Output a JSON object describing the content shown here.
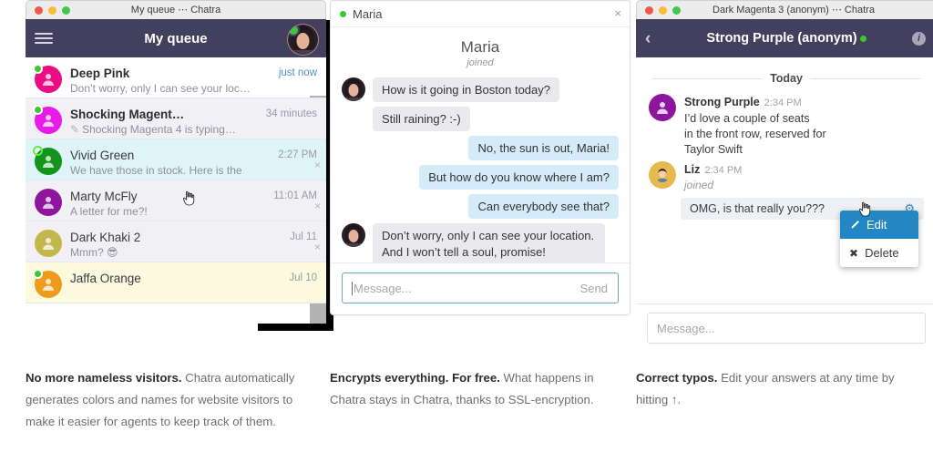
{
  "window1": {
    "titlebar": "My queue ⋯ Chatra",
    "appbar_title": "My queue",
    "menu_icon": "hamburger-icon",
    "rows": [
      {
        "name": "Deep Pink",
        "preview": "Don’t worry, only I can see your loc…",
        "time": "just now",
        "color": "#ec0d86",
        "presence": "solid",
        "typing": false
      },
      {
        "name": "Shocking Magent…",
        "preview": "Shocking Magenta 4 is typing…",
        "time": "34 minutes",
        "color": "#e81ce8",
        "presence": "solid",
        "typing": true
      },
      {
        "name": "Vivid Green",
        "preview": "We have those in stock. Here is the",
        "time": "2:27 PM",
        "color": "#11951b",
        "presence": "ring",
        "typing": false
      },
      {
        "name": "Marty McFly",
        "preview": "A letter for me?!",
        "time": "11:01 AM",
        "color": "#8e169e",
        "presence": "none",
        "typing": false
      },
      {
        "name": "Dark Khaki 2",
        "preview": "Mmm? 😎",
        "time": "Jul 11",
        "color": "#c0b84b",
        "presence": "none",
        "typing": false
      },
      {
        "name": "Jaffa Orange",
        "preview": "",
        "time": "Jul 10",
        "color": "#ef9b1c",
        "presence": "solid",
        "typing": false
      }
    ]
  },
  "window2": {
    "header_name": "Maria",
    "close_label": "×",
    "joined_name": "Maria",
    "joined_label": "joined",
    "messages": [
      {
        "dir": "in",
        "text": "How is it going in Boston today?",
        "avatar": true
      },
      {
        "dir": "in",
        "text": "Still raining? :-)",
        "avatar": false
      },
      {
        "dir": "out",
        "text": "No, the sun is out, Maria!"
      },
      {
        "dir": "out",
        "text": "But how do you know where I am?"
      },
      {
        "dir": "out",
        "text": "Can everybody see that?"
      },
      {
        "dir": "in",
        "text": "Don’t worry, only I can see your location. And I won’t tell a soul, promise!",
        "avatar": true
      }
    ],
    "input_placeholder": "Message...",
    "send_label": "Send"
  },
  "window3": {
    "titlebar": "Dark Magenta 3 (anonym) ⋯ Chatra",
    "appbar_title": "Strong Purple (anonym)",
    "back_icon": "chevron-left-icon",
    "info_icon": "info-icon",
    "day_label": "Today",
    "messages": [
      {
        "name": "Strong Purple",
        "time": "2:34 PM",
        "text": "I’d love a couple of seats\nin the front row, reserved for\nTaylor Swift",
        "color": "#8e169e",
        "joined": false
      },
      {
        "name": "Liz",
        "time": "2:34 PM",
        "text": "joined",
        "color": "#e8b94d",
        "joined": true
      }
    ],
    "agent_bubble": "OMG, is that really you???",
    "gear_icon": "gear-icon",
    "context_menu": [
      {
        "label": "Edit",
        "icon": "pencil-icon",
        "active": true
      },
      {
        "label": "Delete",
        "icon": "x-icon",
        "active": false
      }
    ],
    "input_placeholder": "Message..."
  },
  "captions": [
    {
      "bold": "No more nameless visitors.",
      "rest": " Chatra automatically generates colors and names for website visitors to make it easier for agents to keep track of them."
    },
    {
      "bold": "Encrypts everything. For free.",
      "rest": " What happens in Chatra stays in Chatra, thanks to SSL-encryption."
    },
    {
      "bold": "Correct typos.",
      "rest": " Edit your answers at any time by hitting ↑."
    }
  ],
  "colors": {
    "appbar": "#433f5e",
    "accent_blue": "#2387c6",
    "selected_row": "#dff4f8",
    "outgoing_bubble": "#d5ecf8"
  }
}
